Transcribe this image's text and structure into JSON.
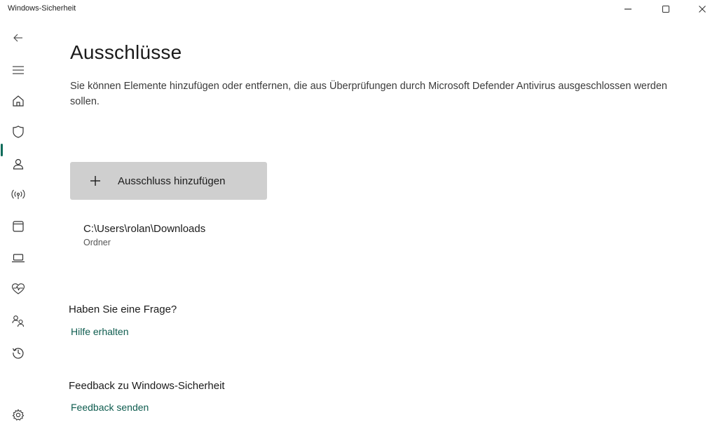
{
  "window": {
    "title": "Windows-Sicherheit",
    "controls": [
      "minimize-icon",
      "maximize-icon",
      "close-icon"
    ]
  },
  "sidebar": {
    "active": "virus-threat-protection",
    "items": [
      {
        "id": "back",
        "icon": "back-arrow-icon"
      },
      {
        "id": "menu",
        "icon": "hamburger-menu-icon"
      },
      {
        "id": "home",
        "icon": "home-icon"
      },
      {
        "id": "virus-threat-protection",
        "icon": "shield-icon"
      },
      {
        "id": "account-protection",
        "icon": "person-icon"
      },
      {
        "id": "firewall-network",
        "icon": "wireless-signal-icon"
      },
      {
        "id": "app-browser-control",
        "icon": "app-window-icon"
      },
      {
        "id": "device-security",
        "icon": "laptop-icon"
      },
      {
        "id": "device-performance",
        "icon": "heart-pulse-icon"
      },
      {
        "id": "family-options",
        "icon": "family-icon"
      },
      {
        "id": "protection-history",
        "icon": "history-icon"
      },
      {
        "id": "settings",
        "icon": "gear-icon"
      }
    ],
    "accent_color": "#0f6b5a"
  },
  "main": {
    "title": "Ausschlüsse",
    "description": "Sie können Elemente hinzufügen oder entfernen, die aus Überprüfungen durch Microsoft Defender Antivirus ausgeschlossen werden sollen.",
    "add_button": {
      "icon": "plus-icon",
      "label": "Ausschluss hinzufügen"
    },
    "exclusions": [
      {
        "path": "C:\\Users\\rolan\\Downloads",
        "type": "Ordner"
      }
    ],
    "help": {
      "heading": "Haben Sie eine Frage?",
      "link": "Hilfe erhalten"
    },
    "feedback": {
      "heading": "Feedback zu Windows-Sicherheit",
      "link": "Feedback senden"
    }
  },
  "colors": {
    "link": "#0e5c4f",
    "button_bg": "#cfcfcf",
    "background": "#ffffff"
  }
}
